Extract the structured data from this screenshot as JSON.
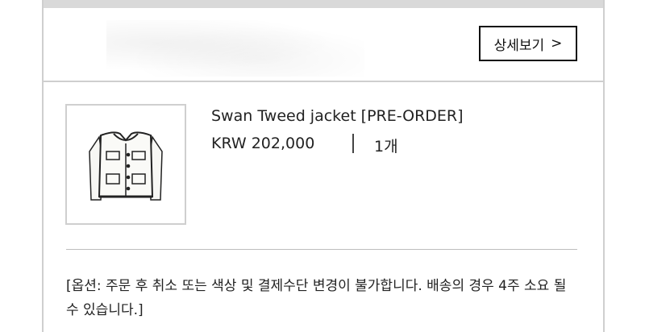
{
  "header": {
    "detail_label": "상세보기",
    "detail_chevron": ">"
  },
  "product": {
    "name": "Swan Tweed jacket [PRE-ORDER]",
    "price": "KRW 202,000",
    "quantity": "1개",
    "image_icon": "tweed-jacket-image"
  },
  "notice": {
    "text": "[옵션: 주문 후 취소 또는 색상 및 결제수단 변경이 불가합니다. 배송의 경우 4주 소요 될 수 있습니다.]"
  },
  "colors": {
    "border": "#cfcfcf",
    "text": "#222222",
    "button_border": "#111111"
  }
}
